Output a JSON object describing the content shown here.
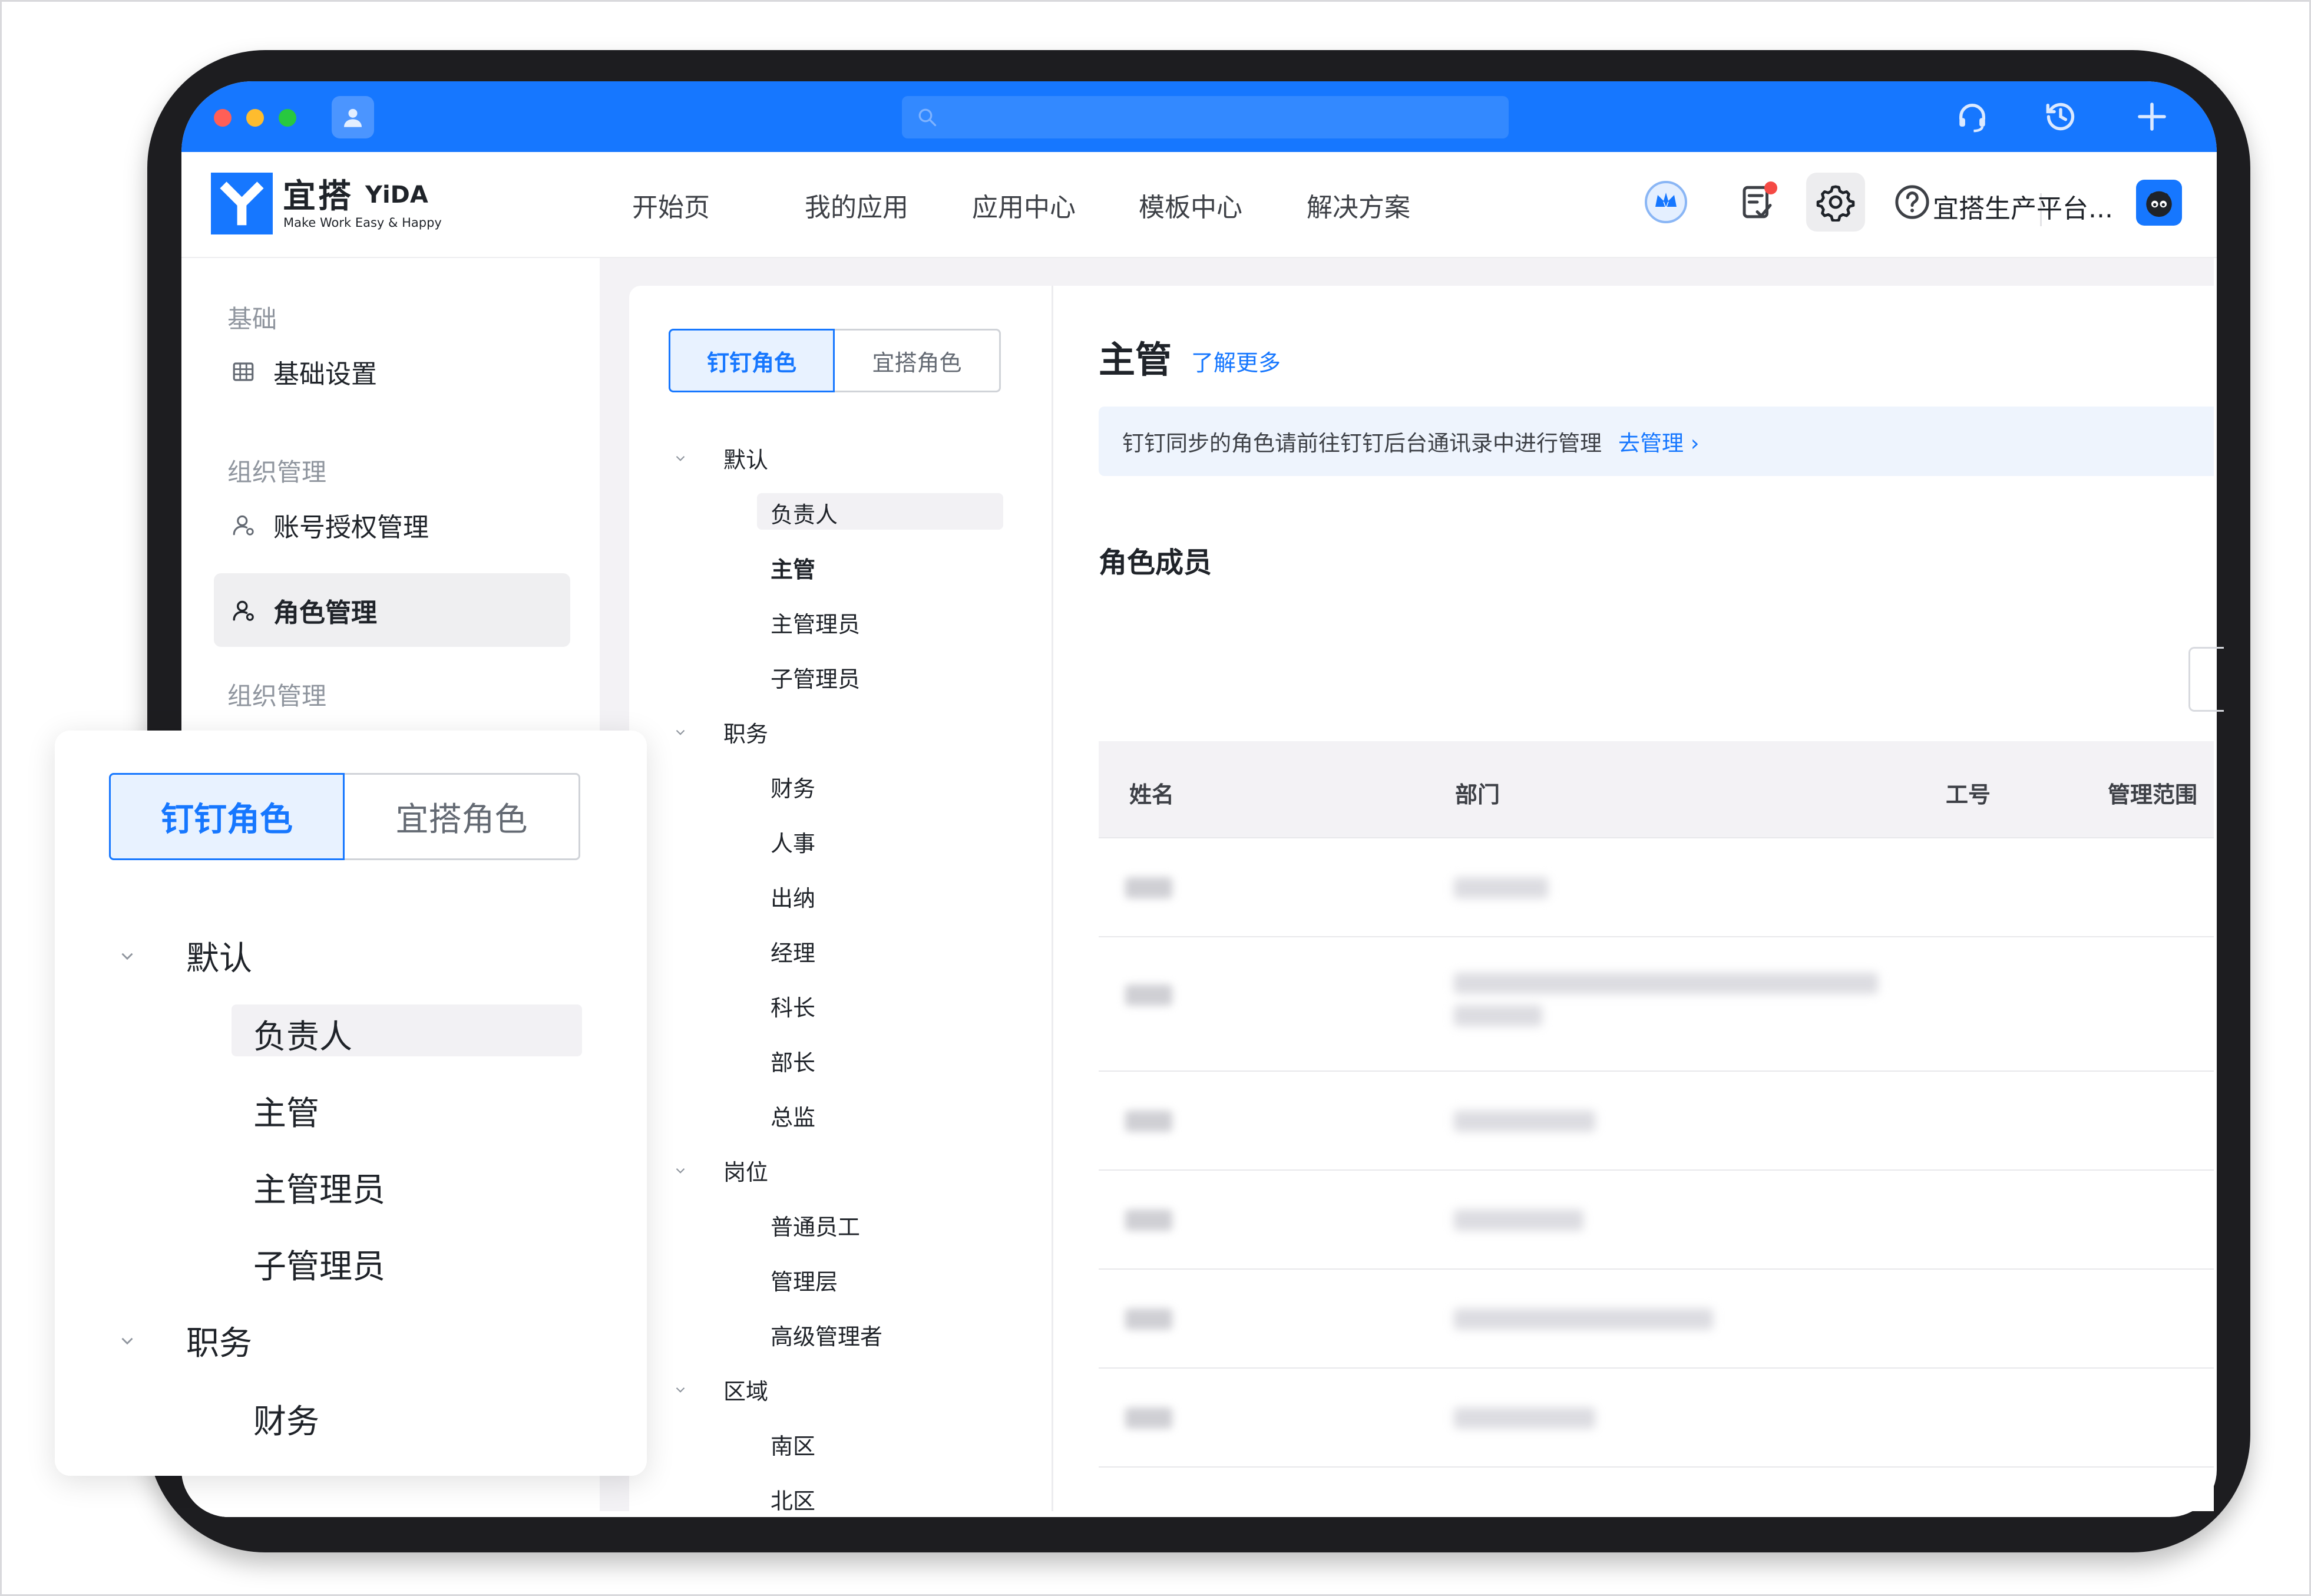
{
  "header": {
    "logo_name": "宜搭",
    "logo_brand": "YiDA",
    "logo_tagline": "Make Work Easy & Happy",
    "nav": [
      "开始页",
      "我的应用",
      "应用中心",
      "模板中心",
      "解决方案"
    ],
    "org_name": "宜搭生产平台..."
  },
  "sidebar": {
    "group_basic": "基础",
    "item_basic_settings": "基础设置",
    "group_org": "组织管理",
    "item_account_auth": "账号授权管理",
    "item_role_mgmt": "角色管理",
    "group_org_2": "组织管理"
  },
  "role_tabs": {
    "dingtalk": "钉钉角色",
    "yida": "宜搭角色"
  },
  "role_tree": [
    {
      "label": "默认",
      "children": [
        "负责人",
        "主管",
        "主管理员",
        "子管理员"
      ]
    },
    {
      "label": "职务",
      "children": [
        "财务",
        "人事",
        "出纳",
        "经理",
        "科长",
        "部长",
        "总监"
      ]
    },
    {
      "label": "岗位",
      "children": [
        "普通员工",
        "管理层",
        "高级管理者"
      ]
    },
    {
      "label": "区域",
      "children": [
        "南区",
        "北区"
      ]
    }
  ],
  "detail": {
    "title": "主管",
    "learn_more": "了解更多",
    "notice_text": "钉钉同步的角色请前往钉钉后台通讯录中进行管理",
    "notice_link": "去管理 ›",
    "members_title": "角色成员"
  },
  "table": {
    "columns": [
      "姓名",
      "部门",
      "工号",
      "管理范围"
    ]
  },
  "colors": {
    "brand_blue": "#1677ff",
    "selected_bg": "#e8f2ff",
    "notice_bg": "#eef4fd",
    "badge_red": "#f54a45"
  },
  "icons": {
    "titlebar": [
      "user-icon",
      "search-icon",
      "headset-icon",
      "history-icon",
      "plus-icon"
    ],
    "header": [
      "crown-badge-icon",
      "todo-icon",
      "gear-icon",
      "help-icon"
    ],
    "sidebar": [
      "grid-icon",
      "user-icon",
      "role-icon"
    ]
  }
}
